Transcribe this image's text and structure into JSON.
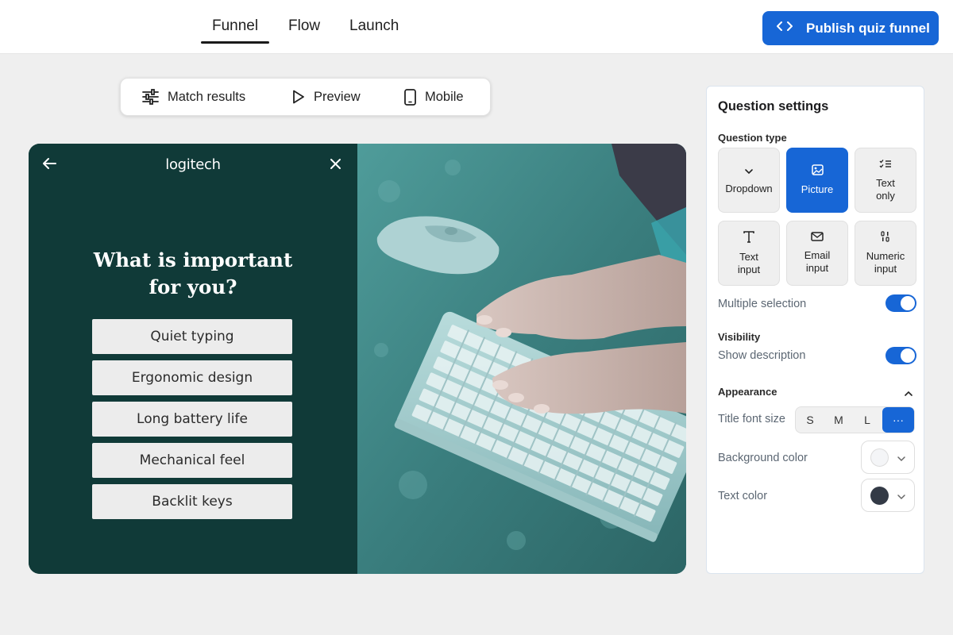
{
  "nav": {
    "tabs": [
      {
        "label": "Funnel",
        "active": true
      },
      {
        "label": "Flow",
        "active": false
      },
      {
        "label": "Launch",
        "active": false
      }
    ],
    "publish_label": "Publish quiz funnel"
  },
  "toolbar": {
    "match_results": "Match results",
    "preview": "Preview",
    "mobile": "Mobile"
  },
  "quiz": {
    "brand": "logitech",
    "title": "What is important for you?",
    "options": [
      "Quiet typing",
      "Ergonomic design",
      "Long battery life",
      "Mechanical feel",
      "Backlit keys"
    ]
  },
  "settings": {
    "title": "Question settings",
    "question_type_label": "Question type",
    "question_types": [
      {
        "label": "Dropdown",
        "icon": "chevron-down-icon",
        "active": false
      },
      {
        "label": "Picture",
        "icon": "image-icon",
        "active": true
      },
      {
        "label": "Text only",
        "icon": "checklist-icon",
        "active": false
      },
      {
        "label": "Text input",
        "icon": "text-icon",
        "active": false
      },
      {
        "label": "Email input",
        "icon": "mail-icon",
        "active": false
      },
      {
        "label": "Numeric input",
        "icon": "numeric-icon",
        "active": false
      }
    ],
    "multiple_selection": {
      "label": "Multiple selection",
      "enabled": true
    },
    "visibility_label": "Visibility",
    "show_description": {
      "label": "Show description",
      "enabled": true
    },
    "appearance_label": "Appearance",
    "title_font_size": {
      "label": "Title font size",
      "options": [
        "S",
        "M",
        "L",
        "···"
      ],
      "selected": "···"
    },
    "background_color": {
      "label": "Background color",
      "value": "#f4f5f7"
    },
    "text_color": {
      "label": "Text color",
      "value": "#333a46"
    }
  },
  "colors": {
    "accent": "#1766d6",
    "quiz_background": "#103a38"
  }
}
